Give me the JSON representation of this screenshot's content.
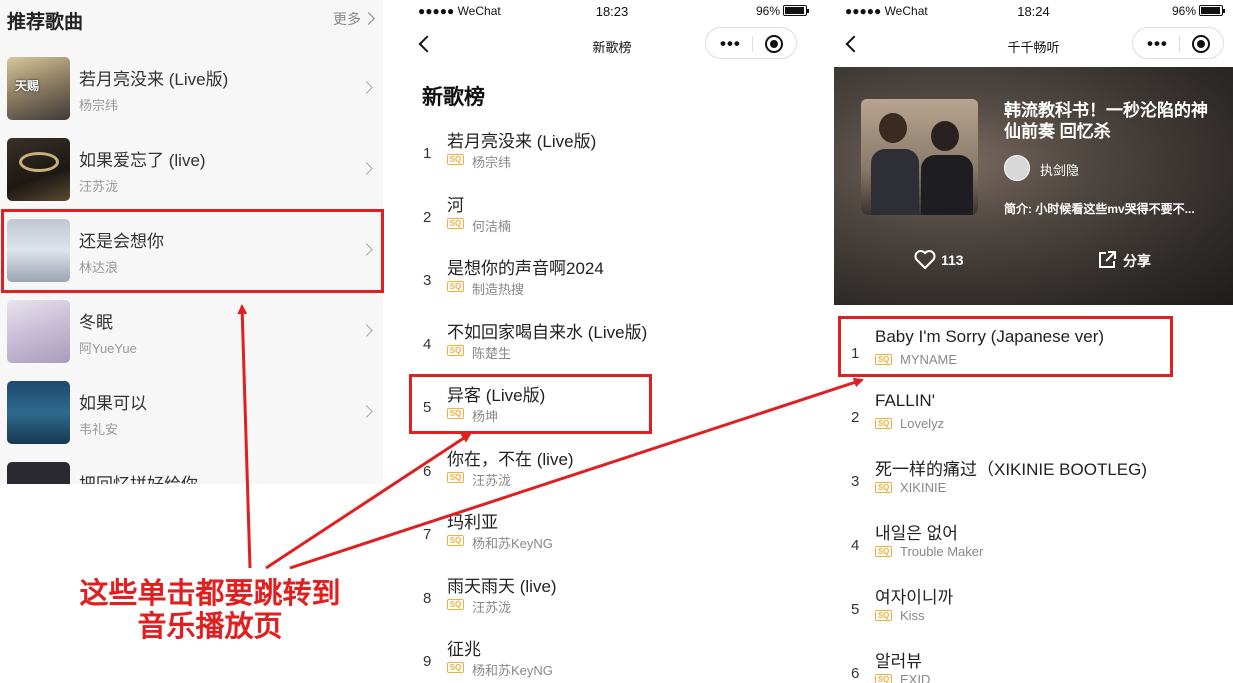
{
  "panel1": {
    "header": "推荐歌曲",
    "more": "更多",
    "songs": [
      {
        "title": "若月亮没来 (Live版)",
        "artist": "杨宗纬"
      },
      {
        "title": "如果爱忘了 (live)",
        "artist": "汪苏泷"
      },
      {
        "title": "还是会想你",
        "artist": "林达浪"
      },
      {
        "title": "冬眠",
        "artist": "阿YueYue"
      },
      {
        "title": "如果可以",
        "artist": "韦礼安"
      },
      {
        "title": "把回忆拼好给你",
        "artist": ""
      }
    ]
  },
  "panel2": {
    "status": {
      "carrier": "●●●●● WeChat",
      "time": "18:23",
      "battery": "96%"
    },
    "nav_title": "新歌榜",
    "big_title": "新歌榜",
    "quality_badge": "SQ",
    "songs": [
      {
        "rank": "1",
        "title": "若月亮没来 (Live版)",
        "artist": "杨宗纬"
      },
      {
        "rank": "2",
        "title": "河",
        "artist": "何洁楠"
      },
      {
        "rank": "3",
        "title": "是想你的声音啊2024",
        "artist": "制造热搜"
      },
      {
        "rank": "4",
        "title": "不如回家喝自来水 (Live版)",
        "artist": "陈楚生"
      },
      {
        "rank": "5",
        "title": "异客 (Live版)",
        "artist": "杨坤"
      },
      {
        "rank": "6",
        "title": "你在，不在 (live)",
        "artist": "汪苏泷"
      },
      {
        "rank": "7",
        "title": "玛利亚",
        "artist": "杨和苏KeyNG"
      },
      {
        "rank": "8",
        "title": "雨天雨天 (live)",
        "artist": "汪苏泷"
      },
      {
        "rank": "9",
        "title": "征兆",
        "artist": "杨和苏KeyNG"
      }
    ]
  },
  "panel3": {
    "status": {
      "carrier": "●●●●● WeChat",
      "time": "18:24",
      "battery": "96%"
    },
    "nav_title": "千千畅听",
    "hero": {
      "title": "韩流教科书！一秒沦陷的神仙前奏 回忆杀",
      "user": "执剑隐",
      "desc": "简介: 小时候看这些mv哭得不要不...",
      "likes": "113",
      "share": "分享"
    },
    "quality_badge": "SQ",
    "songs": [
      {
        "rank": "1",
        "title": "Baby I'm Sorry (Japanese ver)",
        "artist": "MYNAME"
      },
      {
        "rank": "2",
        "title": "FALLIN'",
        "artist": "Lovelyz"
      },
      {
        "rank": "3",
        "title": "死一样的痛过（XIKINIE BOOTLEG)",
        "artist": "XIKINIE"
      },
      {
        "rank": "4",
        "title": "내일은 없어",
        "artist": "Trouble Maker"
      },
      {
        "rank": "5",
        "title": "여자이니까",
        "artist": "Kiss"
      },
      {
        "rank": "6",
        "title": "알러뷰",
        "artist": "EXID"
      }
    ]
  },
  "annotation": {
    "line1": "这些单击都要跳转到",
    "line2": "音乐播放页",
    "color": "#e02020"
  }
}
